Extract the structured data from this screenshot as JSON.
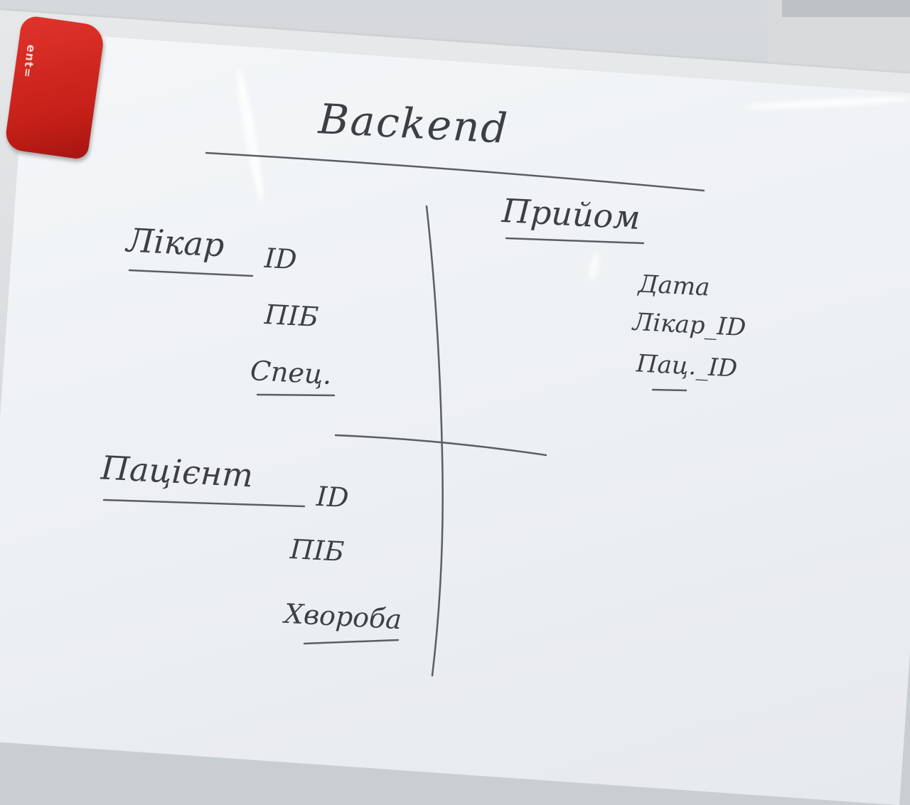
{
  "board": {
    "title": "Backend",
    "eraser_label": "ent=",
    "entities": {
      "doctor": {
        "name": "Лікар",
        "fields": [
          "ID",
          "ПІБ",
          "Спец."
        ]
      },
      "patient": {
        "name": "Пацієнт",
        "fields": [
          "ID",
          "ПІБ",
          "Хвороба"
        ]
      },
      "appointment": {
        "name": "Прийом",
        "fields": [
          "Дата",
          "Лікар_ID",
          "Пац._ID"
        ]
      }
    }
  },
  "colors": {
    "board": "#eef1f4",
    "marker": "#3c3f44",
    "eraser": "#c41f18"
  }
}
